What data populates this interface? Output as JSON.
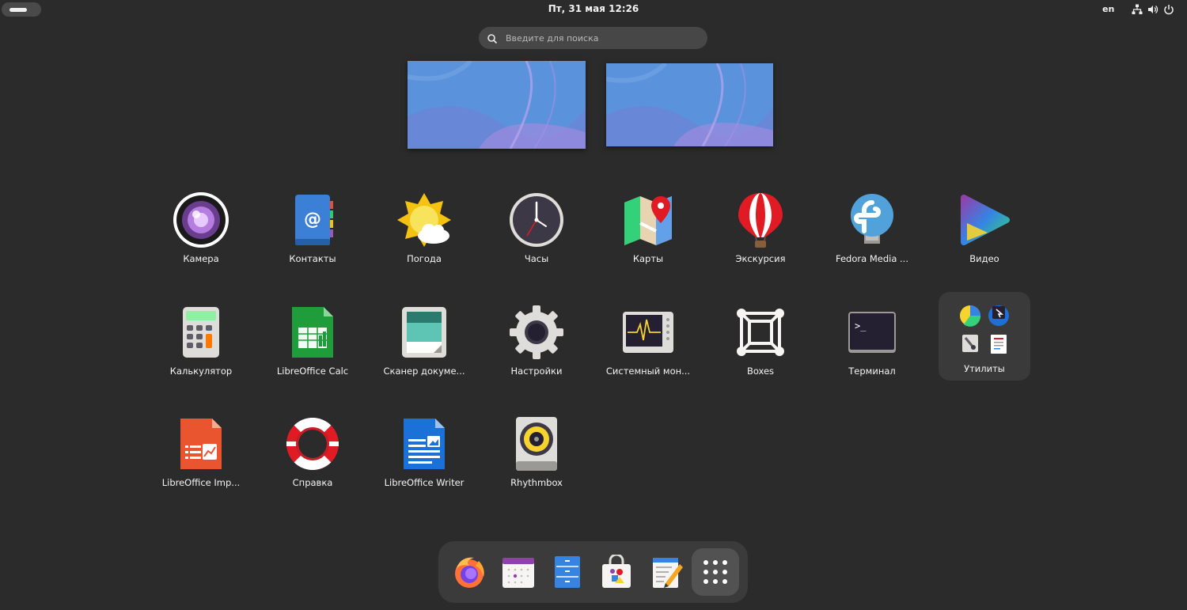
{
  "topbar": {
    "clock": "Пт, 31 мая  12:26",
    "keyboard_layout": "en",
    "status_icons": [
      "network-icon",
      "volume-icon",
      "power-icon"
    ]
  },
  "search": {
    "placeholder": "Введите для поиска",
    "value": ""
  },
  "workspaces": [
    {
      "name": "workspace-1",
      "wallpaper_colors": [
        "#5b8fd8",
        "#6a7fd0",
        "#a48fe0"
      ]
    },
    {
      "name": "workspace-2",
      "wallpaper_colors": [
        "#5b8fd8",
        "#6a7fd0",
        "#a48fe0"
      ]
    }
  ],
  "apps": [
    {
      "label": "Камера",
      "icon": "camera-icon"
    },
    {
      "label": "Контакты",
      "icon": "contacts-icon"
    },
    {
      "label": "Погода",
      "icon": "weather-icon"
    },
    {
      "label": "Часы",
      "icon": "clock-icon"
    },
    {
      "label": "Карты",
      "icon": "maps-icon"
    },
    {
      "label": "Экскурсия",
      "icon": "tour-balloon-icon"
    },
    {
      "label": "Fedora Media ...",
      "icon": "fedora-media-writer-icon"
    },
    {
      "label": "Видео",
      "icon": "video-icon"
    },
    {
      "label": "Калькулятор",
      "icon": "calculator-icon"
    },
    {
      "label": "LibreOffice Calc",
      "icon": "libreoffice-calc-icon"
    },
    {
      "label": "Сканер докуме...",
      "icon": "document-scanner-icon"
    },
    {
      "label": "Настройки",
      "icon": "settings-gear-icon"
    },
    {
      "label": "Системный мон...",
      "icon": "system-monitor-icon"
    },
    {
      "label": "Boxes",
      "icon": "boxes-icon"
    },
    {
      "label": "Терминал",
      "icon": "terminal-icon"
    },
    {
      "label": "Утилиты",
      "icon": "utilities-folder-icon"
    },
    {
      "label": "LibreOffice Imp...",
      "icon": "libreoffice-impress-icon"
    },
    {
      "label": "Справка",
      "icon": "help-lifebuoy-icon"
    },
    {
      "label": "LibreOffice Writer",
      "icon": "libreoffice-writer-icon"
    },
    {
      "label": "Rhythmbox",
      "icon": "rhythmbox-icon"
    }
  ],
  "dock": [
    {
      "name": "firefox",
      "icon": "firefox-icon"
    },
    {
      "name": "calendar",
      "icon": "calendar-icon"
    },
    {
      "name": "files",
      "icon": "files-icon"
    },
    {
      "name": "software",
      "icon": "software-store-icon"
    },
    {
      "name": "text-editor",
      "icon": "text-editor-icon"
    },
    {
      "name": "show-apps",
      "icon": "app-grid-icon"
    }
  ]
}
